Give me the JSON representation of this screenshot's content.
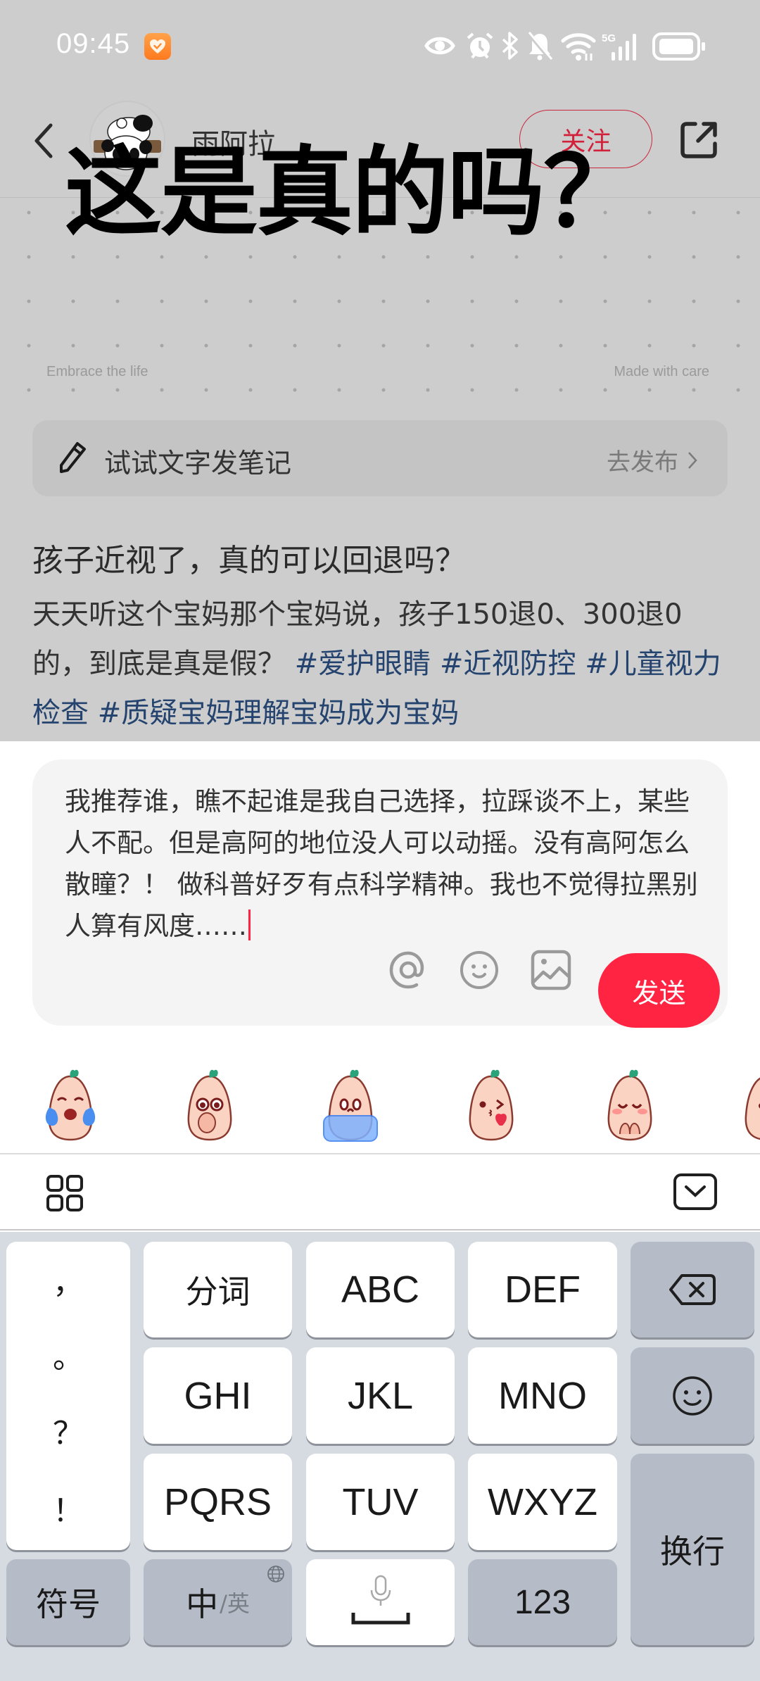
{
  "status_bar": {
    "time": "09:45",
    "network": "5G",
    "icons": [
      "health-app-icon",
      "eye-icon",
      "alarm-icon",
      "bluetooth-icon",
      "mute-icon",
      "wifi-icon",
      "signal-icon",
      "battery-icon"
    ]
  },
  "header": {
    "author_name": "雨阿拉",
    "follow_label": "关注",
    "colors": {
      "follow": "#d2213a"
    }
  },
  "post_image": {
    "title": "这是真的吗？",
    "caption_left": "Embrace the life",
    "caption_right": "Made with care"
  },
  "note_banner": {
    "label": "试试文字发笔记",
    "action": "去发布"
  },
  "post": {
    "title": "孩子近视了，真的可以回退吗？",
    "body": "天天听这个宝妈那个宝妈说，孩子150退0、300退0的，到底是真是假？",
    "tags": [
      "#爱护眼睛",
      "#近视防控",
      "#儿童视力检查",
      "#质疑宝妈理解宝妈成为宝妈"
    ]
  },
  "composer": {
    "text": "我推荐谁，瞧不起谁是我自己选择，拉踩谈不上，某些人不配。但是高阿的地位没人可以动摇。没有高阿怎么散瞳？！ 做科普好歹有点科学精神。我也不觉得拉黑别人算有风度……",
    "send_label": "发送",
    "colors": {
      "send": "#ff2442",
      "caret": "#ff2442"
    }
  },
  "emoji_row": [
    "crying-laugh-emoji",
    "shy-cover-mouth-emoji",
    "flood-tears-emoji",
    "blow-kiss-heart-emoji",
    "pleading-hands-emoji",
    "partial-emoji"
  ],
  "keyboard": {
    "punctuation": [
      "，",
      "。",
      "？",
      "！"
    ],
    "row1": [
      "分词",
      "ABC",
      "DEF"
    ],
    "row2": [
      "GHI",
      "JKL",
      "MNO"
    ],
    "row3": [
      "PQRS",
      "TUV",
      "WXYZ"
    ],
    "symbols_label": "符号",
    "lang_main": "中",
    "lang_sub": "/英",
    "numbers_label": "123",
    "enter_label": "换行"
  }
}
